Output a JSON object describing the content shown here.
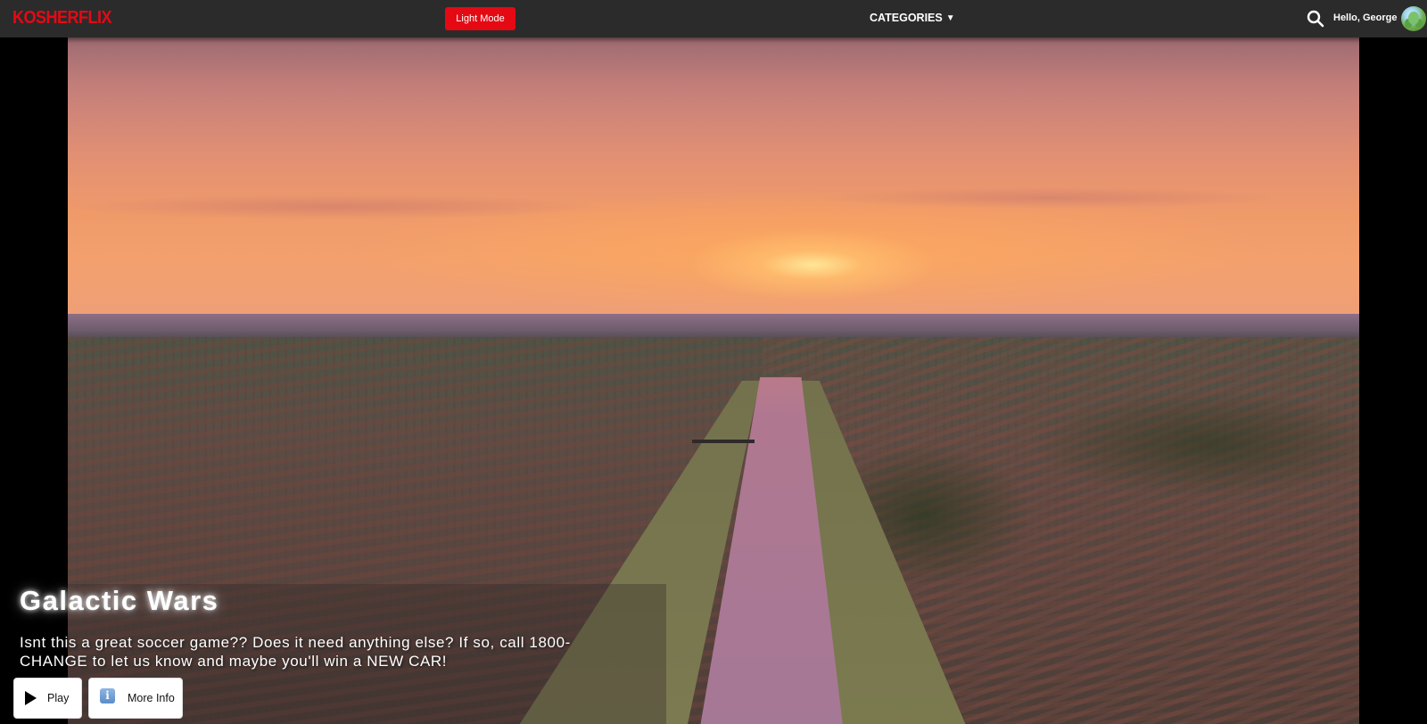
{
  "navbar": {
    "logo": "KOSHERFLIX",
    "light_mode_label": "Light Mode",
    "categories_label": "CATEGORIES",
    "categories_caret": "▼",
    "search_icon": "search-icon",
    "greeting": "Hello, George",
    "avatar_icon": "avatar"
  },
  "hero": {
    "title": "Galactic Wars",
    "description": "Isnt this a great soccer game?? Does it need anything else? If so, call 1800-CHANGE to let us know and maybe you'll win a NEW CAR!",
    "play_label": "Play",
    "play_icon": "play-icon",
    "more_info_label": "More Info",
    "info_icon_glyph": "i"
  },
  "colors": {
    "brand_red": "#e50914",
    "navbar_bg": "#2b2b2b",
    "button_bg": "#ffffff"
  }
}
